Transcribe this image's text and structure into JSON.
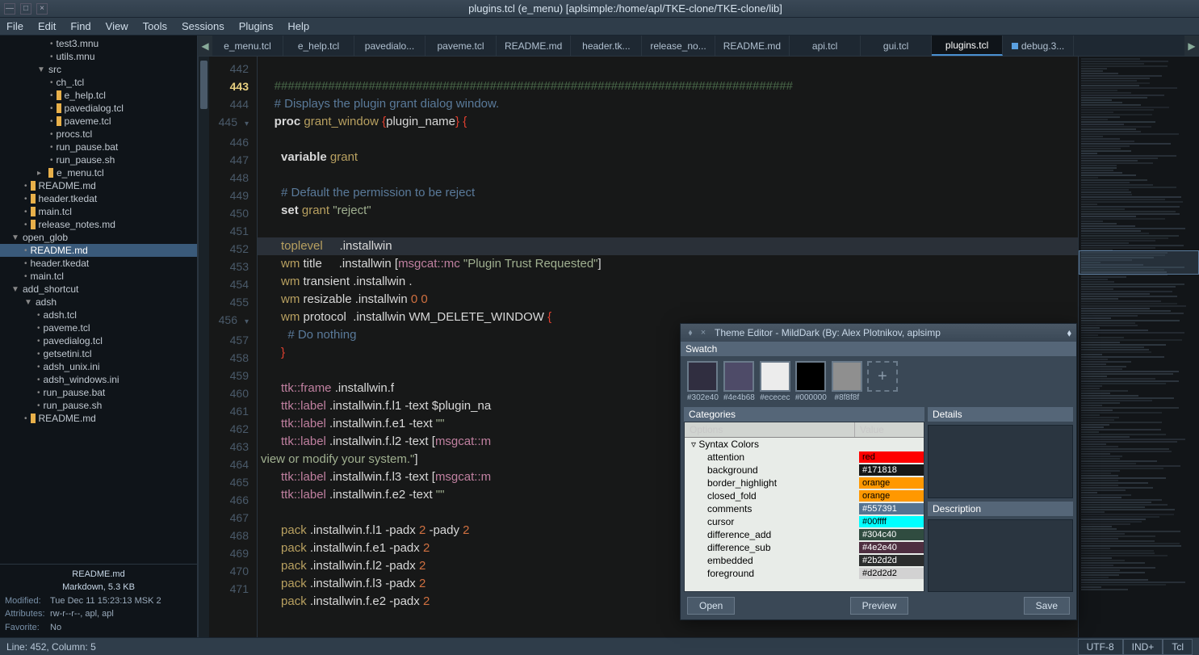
{
  "window": {
    "title": "plugins.tcl (e_menu) [aplsimple:/home/apl/TKE-clone/TKE-clone/lib]"
  },
  "menu": [
    "File",
    "Edit",
    "Find",
    "View",
    "Tools",
    "Sessions",
    "Plugins",
    "Help"
  ],
  "tree": [
    {
      "d": 4,
      "t": "bullet",
      "label": "test3.mnu"
    },
    {
      "d": 4,
      "t": "bullet",
      "label": "utils.mnu"
    },
    {
      "d": 3,
      "t": "exp-down",
      "label": "src"
    },
    {
      "d": 4,
      "t": "bullet",
      "label": "ch_.tcl"
    },
    {
      "d": 4,
      "t": "mark",
      "label": "e_help.tcl"
    },
    {
      "d": 4,
      "t": "mark",
      "label": "pavedialog.tcl"
    },
    {
      "d": 4,
      "t": "mark",
      "label": "paveme.tcl"
    },
    {
      "d": 4,
      "t": "bullet",
      "label": "procs.tcl"
    },
    {
      "d": 4,
      "t": "bullet",
      "label": "run_pause.bat"
    },
    {
      "d": 4,
      "t": "bullet",
      "label": "run_pause.sh"
    },
    {
      "d": 3,
      "t": "mark-exp",
      "label": "e_menu.tcl"
    },
    {
      "d": 2,
      "t": "mark",
      "label": "README.md"
    },
    {
      "d": 2,
      "t": "mark",
      "label": "header.tkedat"
    },
    {
      "d": 2,
      "t": "mark",
      "label": "main.tcl"
    },
    {
      "d": 2,
      "t": "mark",
      "label": "release_notes.md"
    },
    {
      "d": 1,
      "t": "exp-down",
      "label": "open_glob"
    },
    {
      "d": 2,
      "t": "bullet",
      "label": "README.md",
      "sel": true
    },
    {
      "d": 2,
      "t": "bullet",
      "label": "header.tkedat"
    },
    {
      "d": 2,
      "t": "bullet",
      "label": "main.tcl"
    },
    {
      "d": 1,
      "t": "exp-down",
      "label": "add_shortcut"
    },
    {
      "d": 2,
      "t": "exp-down",
      "label": "adsh"
    },
    {
      "d": 3,
      "t": "bullet",
      "label": "adsh.tcl"
    },
    {
      "d": 3,
      "t": "bullet",
      "label": "paveme.tcl"
    },
    {
      "d": 3,
      "t": "bullet",
      "label": "pavedialog.tcl"
    },
    {
      "d": 3,
      "t": "bullet",
      "label": "getsetini.tcl"
    },
    {
      "d": 3,
      "t": "bullet",
      "label": "adsh_unix.ini"
    },
    {
      "d": 3,
      "t": "bullet",
      "label": "adsh_windows.ini"
    },
    {
      "d": 3,
      "t": "bullet",
      "label": "run_pause.bat"
    },
    {
      "d": 3,
      "t": "bullet",
      "label": "run_pause.sh"
    },
    {
      "d": 2,
      "t": "mark",
      "label": "README.md"
    }
  ],
  "fileinfo": {
    "name": "README.md",
    "type": "Markdown, 5.3 KB",
    "modified_label": "Modified:",
    "modified": "Tue Dec 11 15:23:13 MSK 2",
    "attrs_label": "Attributes:",
    "attrs": "rw-r--r--, apl, apl",
    "fav_label": "Favorite:",
    "fav": "No"
  },
  "tabs": [
    {
      "label": "e_menu.tcl"
    },
    {
      "label": "e_help.tcl"
    },
    {
      "label": "pavedialo..."
    },
    {
      "label": "paveme.tcl"
    },
    {
      "label": "README.md"
    },
    {
      "label": "header.tk..."
    },
    {
      "label": "release_no..."
    },
    {
      "label": "README.md"
    },
    {
      "label": "api.tcl"
    },
    {
      "label": "gui.tcl"
    },
    {
      "label": "plugins.tcl",
      "active": true
    },
    {
      "label": "debug.3...",
      "mod": true
    }
  ],
  "gutter_start": 442,
  "gutter_lines": [
    "442",
    "443",
    "444",
    "445",
    "446",
    "447",
    "448",
    "449",
    "450",
    "451",
    "452",
    "453",
    "454",
    "455",
    "456",
    "457",
    "458",
    "459",
    "460",
    "461",
    "462",
    "463",
    "",
    "464",
    "465",
    "466",
    "467",
    "468",
    "469",
    "470",
    "471"
  ],
  "current_line_idx": 1,
  "fold_lines": {
    "3": "▾",
    "14": "▾"
  },
  "code": [
    {
      "html": ""
    },
    {
      "html": "    <span class='c-sep'>#############################################################################</span>"
    },
    {
      "html": "    <span class='c-cmt'># Displays the plugin grant dialog window.</span>"
    },
    {
      "html": "    <span class='c-kw'>proc</span> <span class='c-id'>grant_window</span> <span class='c-brace'>{</span>plugin_name<span class='c-brace'>}</span> <span class='c-brace'>{</span>"
    },
    {
      "html": ""
    },
    {
      "html": "      <span class='c-kw'>variable</span> <span class='c-id'>grant</span>"
    },
    {
      "html": ""
    },
    {
      "html": "      <span class='c-cmt'># Default the permission to be reject</span>"
    },
    {
      "html": "      <span class='c-kw'>set</span> <span class='c-id'>grant</span> <span class='c-str'>\"reject\"</span>"
    },
    {
      "html": ""
    },
    {
      "html": "      <span class='c-id'>toplevel</span>     .installwin",
      "hl": true
    },
    {
      "html": "      <span class='c-id'>wm</span> title     .installwin [<span class='c-func'>msgcat::mc</span> <span class='c-str'>\"Plugin Trust Requested\"</span>]"
    },
    {
      "html": "      <span class='c-id'>wm</span> transient .installwin ."
    },
    {
      "html": "      <span class='c-id'>wm</span> resizable .installwin <span class='c-num'>0 0</span>"
    },
    {
      "html": "      <span class='c-id'>wm</span> protocol  .installwin WM_DELETE_WINDOW <span class='c-brace'>{</span>"
    },
    {
      "html": "        <span class='c-cmt'># Do nothing</span>"
    },
    {
      "html": "      <span class='c-brace'>}</span>"
    },
    {
      "html": ""
    },
    {
      "html": "      <span class='c-func'>ttk::frame</span> .installwin.f"
    },
    {
      "html": "      <span class='c-func'>ttk::label</span> .installwin.f.l1 -text $plugin_na"
    },
    {
      "html": "      <span class='c-func'>ttk::label</span> .installwin.f.e1 -text <span class='c-str'>\"\"</span>"
    },
    {
      "html": "      <span class='c-func'>ttk::label</span> .installwin.f.l2 -text [<span class='c-func'>msgcat::m</span>"
    },
    {
      "html": "<span class='c-str'>view or modify your system.\"</span>]"
    },
    {
      "html": "      <span class='c-func'>ttk::label</span> .installwin.f.l3 -text [<span class='c-func'>msgcat::m</span>"
    },
    {
      "html": "      <span class='c-func'>ttk::label</span> .installwin.f.e2 -text <span class='c-str'>\"\"</span>"
    },
    {
      "html": ""
    },
    {
      "html": "      <span class='c-id'>pack</span> .installwin.f.l1 -padx <span class='c-num'>2</span> -pady <span class='c-num'>2</span>"
    },
    {
      "html": "      <span class='c-id'>pack</span> .installwin.f.e1 -padx <span class='c-num'>2</span>"
    },
    {
      "html": "      <span class='c-id'>pack</span> .installwin.f.l2 -padx <span class='c-num'>2</span>"
    },
    {
      "html": "      <span class='c-id'>pack</span> .installwin.f.l3 -padx <span class='c-num'>2</span>"
    },
    {
      "html": "      <span class='c-id'>pack</span> .installwin.f.e2 -padx <span class='c-num'>2</span>"
    }
  ],
  "status": {
    "left": "Line: 452, Column: 5",
    "right": [
      "UTF-8",
      "IND+",
      "Tcl"
    ]
  },
  "theme_editor": {
    "title": "Theme Editor - MildDark  (By: Alex Plotnikov, aplsimp",
    "swatch_label": "Swatch",
    "swatches": [
      {
        "color": "#302e40",
        "label": "#302e40"
      },
      {
        "color": "#4e4b68",
        "label": "#4e4b68"
      },
      {
        "color": "#ececec",
        "label": "#ececec"
      },
      {
        "color": "#000000",
        "label": "#000000"
      },
      {
        "color": "#8f8f8f",
        "label": "#8f8f8f"
      }
    ],
    "categories_label": "Categories",
    "details_label": "Details",
    "description_label": "Description",
    "options_hdr": "Options",
    "value_hdr": "Value",
    "group_label": "Syntax Colors",
    "rows": [
      {
        "name": "attention",
        "val": "red",
        "bg": "#ff0000"
      },
      {
        "name": "background",
        "val": "#171818",
        "bg": "#171818",
        "fg": "#fff"
      },
      {
        "name": "border_highlight",
        "val": "orange",
        "bg": "#ff9800"
      },
      {
        "name": "closed_fold",
        "val": "orange",
        "bg": "#ff9800"
      },
      {
        "name": "comments",
        "val": "#557391",
        "bg": "#557391",
        "fg": "#fff"
      },
      {
        "name": "cursor",
        "val": "#00ffff",
        "bg": "#00ffff"
      },
      {
        "name": "difference_add",
        "val": "#304c40",
        "bg": "#304c40",
        "fg": "#fff"
      },
      {
        "name": "difference_sub",
        "val": "#4e2e40",
        "bg": "#4e2e40",
        "fg": "#fff"
      },
      {
        "name": "embedded",
        "val": "#2b2d2d",
        "bg": "#2b2d2d",
        "fg": "#fff"
      },
      {
        "name": "foreground",
        "val": "#d2d2d2",
        "bg": "#d2d2d2"
      }
    ],
    "btn_open": "Open",
    "btn_preview": "Preview",
    "btn_save": "Save"
  }
}
